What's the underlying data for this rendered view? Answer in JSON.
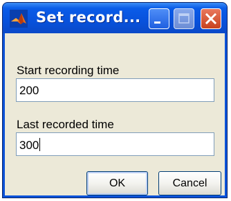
{
  "window": {
    "title": "Set record..."
  },
  "form": {
    "start_label": "Start recording time",
    "start_value": "200",
    "last_label": "Last recorded time",
    "last_value": "300"
  },
  "buttons": {
    "ok_label": "OK",
    "cancel_label": "Cancel"
  },
  "icons": {
    "app": "matlab-logo-icon",
    "minimize": "minimize-icon",
    "maximize": "maximize-icon",
    "close": "close-icon"
  },
  "colors": {
    "titlebar": "#0852dc",
    "client_background": "#ece9d8",
    "close_button": "#c8421f",
    "field_border": "#7f9db9"
  }
}
